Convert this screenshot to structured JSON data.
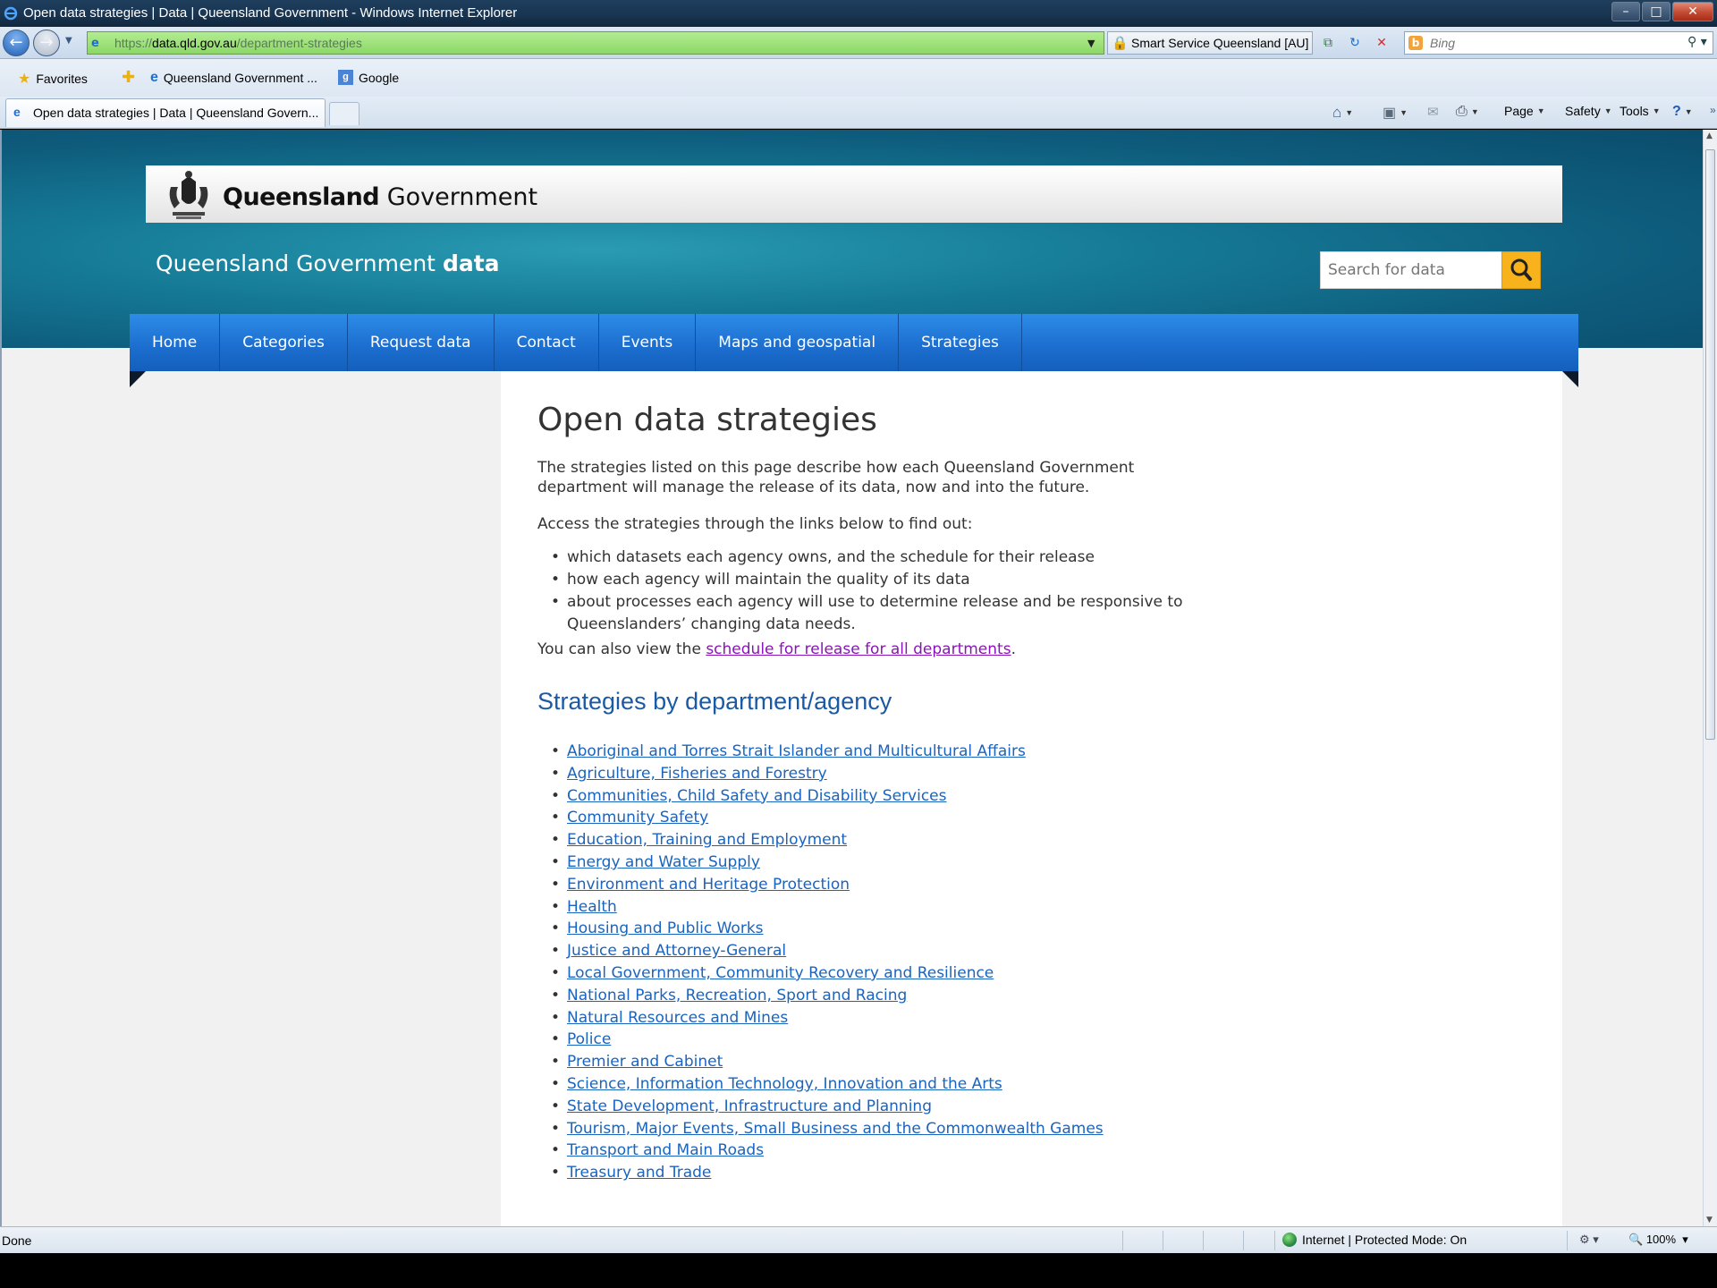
{
  "window": {
    "title": "Open data strategies | Data | Queensland Government - Windows Internet Explorer",
    "controls": {
      "minimize": "–",
      "maximize": "□",
      "close": "✕"
    }
  },
  "navbar": {
    "url_proto": "https://",
    "url_host": "data.qld.gov.au",
    "url_path": "/department-strategies",
    "security_label": "Smart Service Queensland [AU]",
    "search_placeholder": "Bing"
  },
  "favorites": {
    "favorites_label": "Favorites",
    "items": [
      "Queensland Government ...",
      "Google"
    ]
  },
  "tabs": {
    "active_label": "Open data strategies | Data | Queensland Govern...",
    "commands": {
      "page": "Page",
      "safety": "Safety",
      "tools": "Tools"
    }
  },
  "site": {
    "gov_word_bold": "Queensland",
    "gov_word_rest": " Government",
    "title_prefix": "Queensland Government ",
    "title_bold": "data",
    "search_placeholder": "Search for data",
    "nav": [
      "Home",
      "Categories",
      "Request data",
      "Contact",
      "Events",
      "Maps and geospatial",
      "Strategies"
    ]
  },
  "content": {
    "page_title": "Open data strategies",
    "intro": "The strategies listed on this page describe how each Queensland Government department will manage the release of its data, now and into the future.",
    "access": "Access the strategies through the links below to find out:",
    "points": [
      "which datasets each agency owns, and the schedule for their release",
      "how each agency will maintain the quality of its data",
      "about processes each agency will use to determine release and be responsive to Queenslanders’ changing data needs."
    ],
    "also_prefix": "You can also view the ",
    "also_link": "schedule for release for all departments",
    "also_suffix": ".",
    "dept_heading": "Strategies by department/agency",
    "departments": [
      "Aboriginal and Torres Strait Islander and Multicultural Affairs",
      "Agriculture, Fisheries and Forestry",
      "Communities, Child Safety and Disability Services",
      "Community Safety",
      "Education, Training and Employment",
      "Energy and Water Supply",
      "Environment and Heritage Protection",
      "Health",
      "Housing and Public Works",
      "Justice and Attorney-General",
      "Local Government, Community Recovery and Resilience",
      "National Parks, Recreation, Sport and Racing",
      "Natural Resources and Mines",
      "Police",
      "Premier and Cabinet",
      "Science, Information Technology, Innovation and the Arts",
      "State Development, Infrastructure and Planning",
      "Tourism, Major Events, Small Business and the Commonwealth Games",
      "Transport and Main Roads",
      "Treasury and Trade"
    ]
  },
  "statusbar": {
    "status": "Done",
    "zone": "Internet | Protected Mode: On",
    "zoom": "100%"
  },
  "icons": {
    "browser": "ie-icon",
    "back": "back-arrow-icon",
    "forward": "forward-arrow-icon",
    "lock": "lock-icon",
    "refresh": "refresh-icon",
    "stop": "stop-icon",
    "search": "magnifier-icon",
    "home": "home-icon",
    "feeds": "rss-feed-icon",
    "mail": "mail-icon",
    "print": "printer-icon",
    "help": "help-icon"
  },
  "colors": {
    "nav_blue": "#1d6fd0",
    "search_button": "#f7b21c",
    "link": "#1a64bf",
    "visited_link": "#8c13b7",
    "heading_blue": "#1a5aa5"
  }
}
